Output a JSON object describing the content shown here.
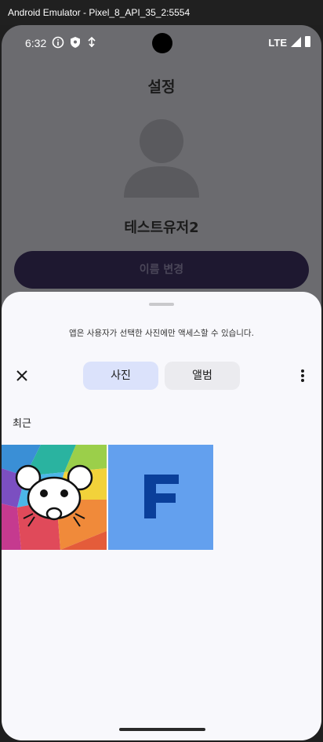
{
  "window": {
    "title": "Android Emulator - Pixel_8_API_35_2:5554"
  },
  "status_bar": {
    "time": "6:32",
    "network": "LTE",
    "icons": [
      "info-icon",
      "shield-icon",
      "mic-icon",
      "signal-icon",
      "battery-icon"
    ]
  },
  "settings": {
    "title": "설정",
    "username": "테스트유저2",
    "rename_button": "이름 변경"
  },
  "picker": {
    "notice": "앱은 사용자가 선택한 사진에만 액세스할 수 있습니다.",
    "tabs": [
      {
        "label": "사진",
        "selected": true
      },
      {
        "label": "앨범",
        "selected": false
      }
    ],
    "section_label": "최근",
    "photos": [
      {
        "name": "colorful-mouse-photo"
      },
      {
        "name": "letter-f-photo",
        "letter": "F"
      }
    ]
  },
  "colors": {
    "accent_tab": "#dbe2fb",
    "photo_f_bg": "#63a0ee",
    "photo_f_letter": "#0a3f9a",
    "sheet_bg": "#f8f8fc"
  }
}
